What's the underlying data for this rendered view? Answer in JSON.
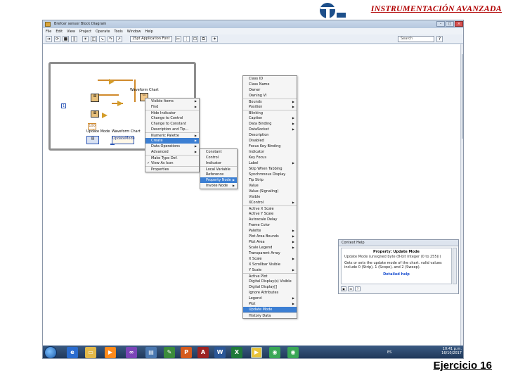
{
  "slide": {
    "title": "INSTRUMENTACIÓN AVANZADA",
    "footer": "Ejercicio 16"
  },
  "window": {
    "title": "Brefcer sensor Block Diagram",
    "menu": [
      "File",
      "Edit",
      "View",
      "Project",
      "Operate",
      "Tools",
      "Window",
      "Help"
    ],
    "font_select": "15pt Application Font",
    "search_placeholder": "Search",
    "help_label": "?"
  },
  "diagram": {
    "numeric_constant": "1",
    "chart_label": "Waveform Chart",
    "chart2_label": "Waveform Chart",
    "update_mode_label": "Update Mode",
    "property_item": "UpdateMode",
    "const_value": "100"
  },
  "menu1": {
    "items": [
      {
        "label": "Visible Items",
        "arrow": true,
        "sep": false
      },
      {
        "label": "Find",
        "arrow": true,
        "sep": false
      },
      {
        "label": "Hide Indicator",
        "arrow": false,
        "sep": true
      },
      {
        "label": "Change to Control",
        "arrow": false,
        "sep": false
      },
      {
        "label": "Change to Constant",
        "arrow": false,
        "sep": false
      },
      {
        "label": "Description and Tip...",
        "arrow": false,
        "sep": false
      },
      {
        "label": "Numeric Palette",
        "arrow": true,
        "sep": true
      },
      {
        "label": "Create",
        "arrow": true,
        "sep": false,
        "hl": true
      },
      {
        "label": "Data Operations",
        "arrow": true,
        "sep": false
      },
      {
        "label": "Advanced",
        "arrow": true,
        "sep": false
      },
      {
        "label": "Make Type Def.",
        "arrow": false,
        "sep": true
      },
      {
        "label": "View As Icon",
        "arrow": false,
        "sep": false,
        "check": true
      },
      {
        "label": "Properties",
        "arrow": false,
        "sep": true
      }
    ]
  },
  "menu2": {
    "items": [
      {
        "label": "Constant",
        "arrow": false
      },
      {
        "label": "Control",
        "arrow": false
      },
      {
        "label": "Indicator",
        "arrow": false
      },
      {
        "label": "Local Variable",
        "arrow": false,
        "sep": true
      },
      {
        "label": "Reference",
        "arrow": false
      },
      {
        "label": "Property Node",
        "arrow": true,
        "hl": true
      },
      {
        "label": "Invoke Node",
        "arrow": true
      }
    ]
  },
  "menu3": {
    "items": [
      {
        "label": "Class ID"
      },
      {
        "label": "Class Name"
      },
      {
        "label": "Owner"
      },
      {
        "label": "Owning VI"
      },
      {
        "label": "Bounds",
        "arrow": true,
        "sep": true
      },
      {
        "label": "Position",
        "arrow": true
      },
      {
        "label": "Blinking",
        "sep": true
      },
      {
        "label": "Caption",
        "arrow": true
      },
      {
        "label": "Data Binding",
        "arrow": true
      },
      {
        "label": "DataSocket",
        "arrow": true
      },
      {
        "label": "Description"
      },
      {
        "label": "Disabled"
      },
      {
        "label": "Focus Key Binding"
      },
      {
        "label": "Indicator"
      },
      {
        "label": "Key Focus"
      },
      {
        "label": "Label",
        "arrow": true
      },
      {
        "label": "Skip When Tabbing"
      },
      {
        "label": "Synchronous Display"
      },
      {
        "label": "Tip Strip"
      },
      {
        "label": "Value"
      },
      {
        "label": "Value (Signaling)"
      },
      {
        "label": "Visible"
      },
      {
        "label": "XControl",
        "arrow": true
      },
      {
        "label": "Active X Scale",
        "sep": true
      },
      {
        "label": "Active Y Scale"
      },
      {
        "label": "Autoscale Delay"
      },
      {
        "label": "Frame Color"
      },
      {
        "label": "Palette",
        "arrow": true
      },
      {
        "label": "Plot Area Bounds",
        "arrow": true
      },
      {
        "label": "Plot Area",
        "arrow": true
      },
      {
        "label": "Scale Legend",
        "arrow": true
      },
      {
        "label": "Transparent Array"
      },
      {
        "label": "X Scale",
        "arrow": true
      },
      {
        "label": "X Scrollbar Visible"
      },
      {
        "label": "Y Scale",
        "arrow": true
      },
      {
        "label": "Active Plot",
        "sep": true
      },
      {
        "label": "Digital Display(s) Visible"
      },
      {
        "label": "Digital Display[]"
      },
      {
        "label": "Ignore Attributes"
      },
      {
        "label": "Legend",
        "arrow": true
      },
      {
        "label": "Plot",
        "arrow": true
      },
      {
        "label": "Update Mode",
        "hl": true
      },
      {
        "label": "History Data",
        "sep": true
      }
    ]
  },
  "context_help": {
    "title": "Context Help",
    "heading": "Property: Update Mode",
    "line1": "Update Mode (unsigned byte (8-bit integer (0 to 255)))",
    "desc": "Gets or sets the update mode of the chart. valid values include 0 (Strip), 1 (Scope), and 2 (Sweep).",
    "link": "Detailed help"
  },
  "taskbar": {
    "lang": "ES",
    "time": "10:41 p.m.",
    "date": "16/10/2017"
  },
  "colors": {
    "title_red": "#b00000",
    "menu_highlight": "#3c7fd3",
    "wire_orange": "#d08a2c",
    "wire_blue": "#2b55b5"
  }
}
